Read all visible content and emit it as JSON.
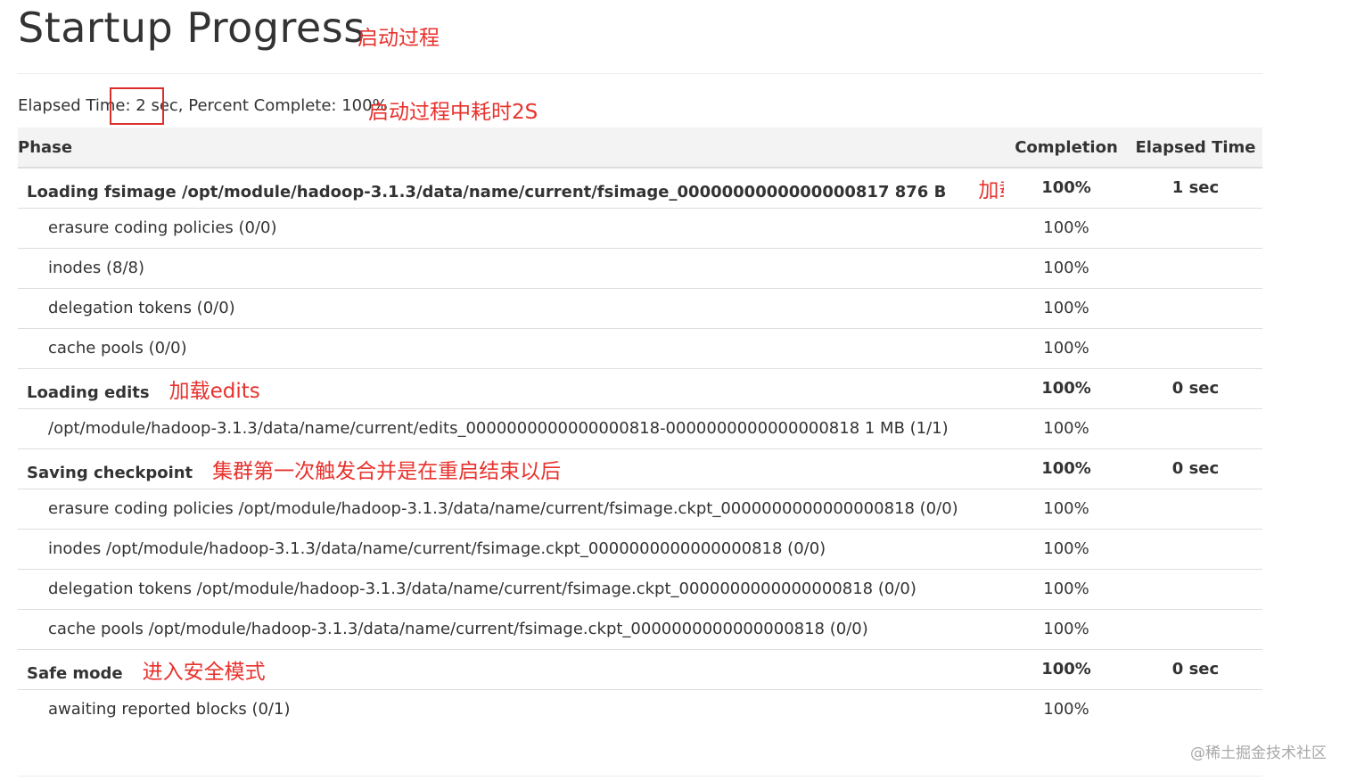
{
  "page": {
    "title": "Startup Progress",
    "title_annotation": "启动过程"
  },
  "summary": {
    "text": "Elapsed Time: 2 sec, Percent Complete: 100%",
    "annotation": "启动过程中耗时2S"
  },
  "table": {
    "headers": {
      "phase": "Phase",
      "completion": "Completion",
      "elapsed": "Elapsed Time"
    },
    "rows": [
      {
        "type": "phase",
        "name": "Loading fsimage /opt/module/hadoop-3.1.3/data/name/current/fsimage_0000000000000000817 876 B",
        "annotation": "加载fsimage",
        "completion": "100%",
        "elapsed": "1 sec"
      },
      {
        "type": "step",
        "name": "erasure coding policies (0/0)",
        "completion": "100%"
      },
      {
        "type": "step",
        "name": "inodes (8/8)",
        "completion": "100%"
      },
      {
        "type": "step",
        "name": "delegation tokens (0/0)",
        "completion": "100%"
      },
      {
        "type": "step",
        "name": "cache pools (0/0)",
        "completion": "100%"
      },
      {
        "type": "phase",
        "name": "Loading edits",
        "annotation": "加载edits",
        "completion": "100%",
        "elapsed": "0 sec"
      },
      {
        "type": "step",
        "name": "/opt/module/hadoop-3.1.3/data/name/current/edits_0000000000000000818-0000000000000000818 1 MB (1/1)",
        "completion": "100%"
      },
      {
        "type": "phase",
        "name": "Saving checkpoint",
        "annotation": "集群第一次触发合并是在重启结束以后",
        "completion": "100%",
        "elapsed": "0 sec"
      },
      {
        "type": "step",
        "name": "erasure coding policies /opt/module/hadoop-3.1.3/data/name/current/fsimage.ckpt_0000000000000000818 (0/0)",
        "completion": "100%"
      },
      {
        "type": "step",
        "name": "inodes /opt/module/hadoop-3.1.3/data/name/current/fsimage.ckpt_0000000000000000818 (0/0)",
        "completion": "100%"
      },
      {
        "type": "step",
        "name": "delegation tokens /opt/module/hadoop-3.1.3/data/name/current/fsimage.ckpt_0000000000000000818 (0/0)",
        "completion": "100%"
      },
      {
        "type": "step",
        "name": "cache pools /opt/module/hadoop-3.1.3/data/name/current/fsimage.ckpt_0000000000000000818 (0/0)",
        "completion": "100%"
      },
      {
        "type": "phase",
        "name": "Safe mode",
        "annotation": "进入安全模式",
        "completion": "100%",
        "elapsed": "0 sec"
      },
      {
        "type": "step",
        "name": "awaiting reported blocks (0/1)",
        "completion": "100%"
      }
    ]
  },
  "watermark": "@稀土掘金技术社区",
  "colors": {
    "annotation": "#e8322d",
    "highlight_box": "#d9302b",
    "header_bg": "#f3f3f3",
    "row_border": "#dddddd",
    "text": "#333333"
  }
}
